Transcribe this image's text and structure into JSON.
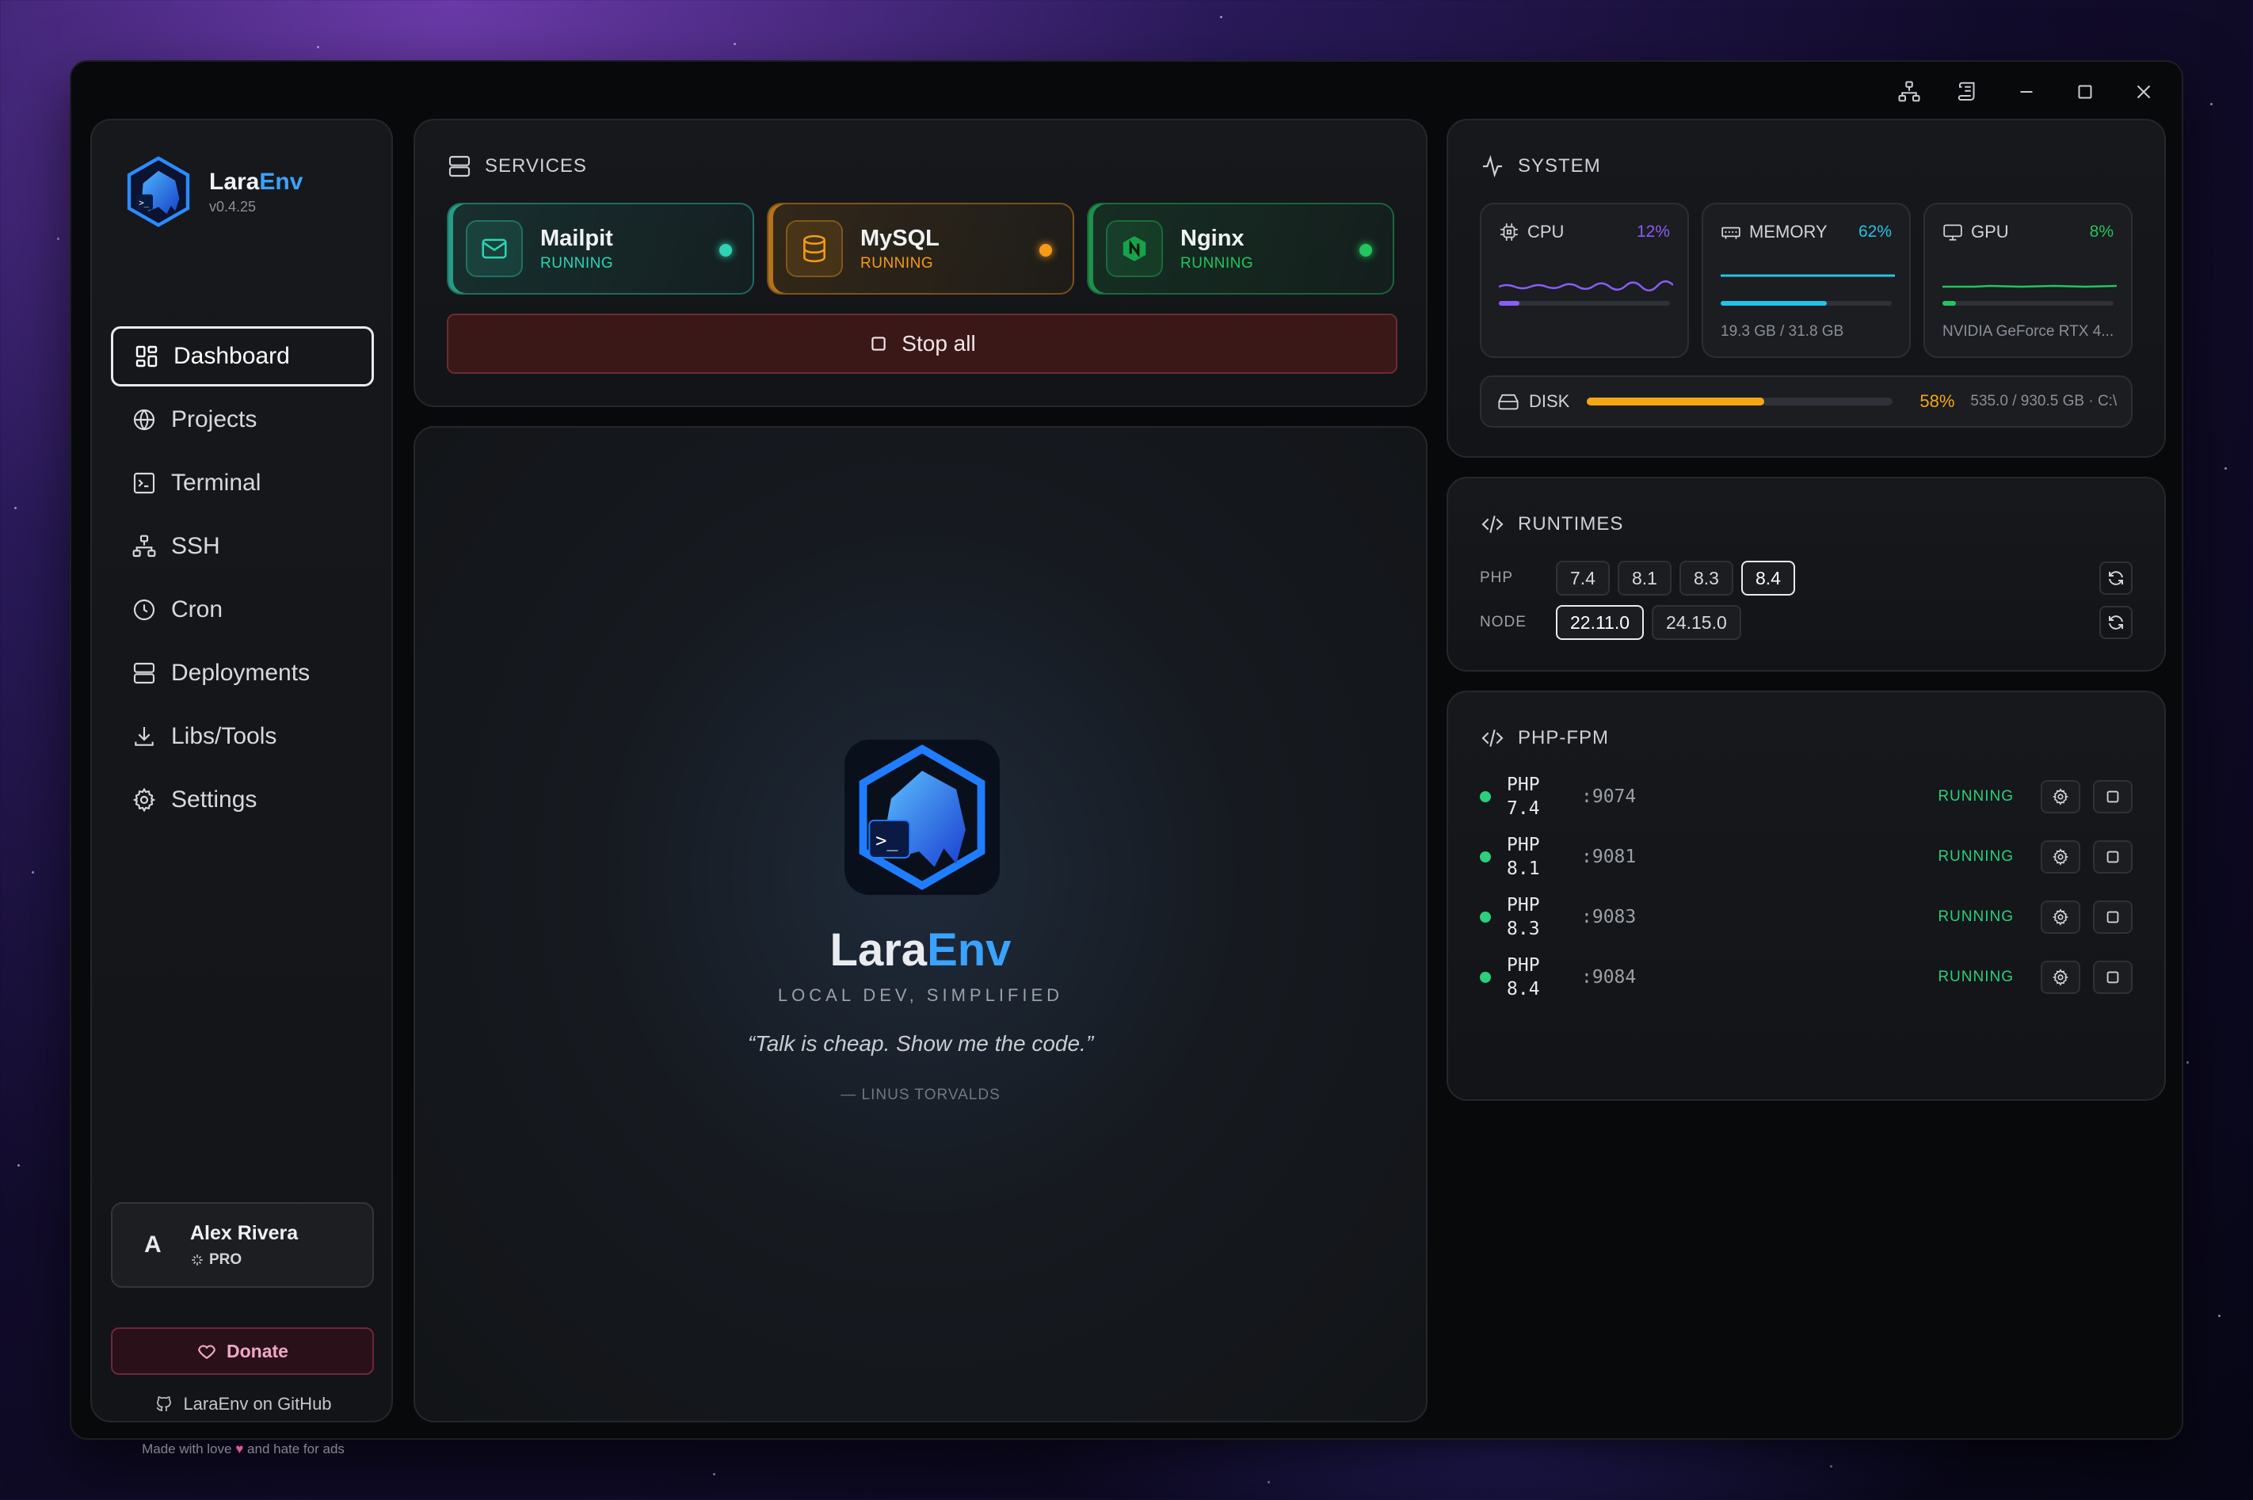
{
  "app": {
    "name_a": "Lara",
    "name_b": "Env",
    "version": "v0.4.25"
  },
  "sidebar": {
    "items": [
      {
        "label": "Dashboard",
        "icon": "dashboard-icon",
        "active": true
      },
      {
        "label": "Projects",
        "icon": "globe-icon"
      },
      {
        "label": "Terminal",
        "icon": "terminal-icon"
      },
      {
        "label": "SSH",
        "icon": "network-icon"
      },
      {
        "label": "Cron",
        "icon": "clock-icon"
      },
      {
        "label": "Deployments",
        "icon": "server-icon"
      },
      {
        "label": "Libs/Tools",
        "icon": "download-icon"
      },
      {
        "label": "Settings",
        "icon": "gear-icon"
      }
    ],
    "user": {
      "initial": "A",
      "name": "Alex Rivera",
      "plan": "PRO"
    },
    "donate": "Donate",
    "github": "LaraEnv on GitHub",
    "made_a": "Made with love",
    "made_b": "and hate for ads"
  },
  "services": {
    "title": "SERVICES",
    "items": [
      {
        "name": "Mailpit",
        "status": "RUNNING",
        "color": "#2fd3b3"
      },
      {
        "name": "MySQL",
        "status": "RUNNING",
        "color": "#f59b1a"
      },
      {
        "name": "Nginx",
        "status": "RUNNING",
        "color": "#22c55e"
      }
    ],
    "stop_all": "Stop all"
  },
  "hero": {
    "title_a": "Lara",
    "title_b": "Env",
    "tagline": "LOCAL DEV, SIMPLIFIED",
    "quote": "“Talk is cheap. Show me the code.”",
    "author": "— LINUS TORVALDS"
  },
  "system": {
    "title": "SYSTEM",
    "cpu": {
      "label": "CPU",
      "pct": "12%",
      "value": 0.12,
      "color": "#8b5cf6"
    },
    "memory": {
      "label": "MEMORY",
      "pct": "62%",
      "value": 0.62,
      "sub": "19.3 GB / 31.8 GB",
      "color": "#22c3e6"
    },
    "gpu": {
      "label": "GPU",
      "pct": "8%",
      "value": 0.08,
      "sub": "NVIDIA GeForce RTX 4...",
      "color": "#22c55e"
    },
    "disk": {
      "label": "DISK",
      "pct": "58%",
      "value": 0.58,
      "size": "535.0 / 930.5 GB · C:\\"
    }
  },
  "runtimes": {
    "title": "RUNTIMES",
    "php": {
      "label": "PHP",
      "versions": [
        "7.4",
        "8.1",
        "8.3",
        "8.4"
      ],
      "selected": "8.4"
    },
    "node": {
      "label": "NODE",
      "versions": [
        "22.11.0",
        "24.15.0"
      ],
      "selected": "22.11.0"
    }
  },
  "fpm": {
    "title": "PHP-FPM",
    "rows": [
      {
        "version": "PHP\n7.4",
        "port": ":9074",
        "status": "RUNNING"
      },
      {
        "version": "PHP\n8.1",
        "port": ":9081",
        "status": "RUNNING"
      },
      {
        "version": "PHP\n8.3",
        "port": ":9083",
        "status": "RUNNING"
      },
      {
        "version": "PHP\n8.4",
        "port": ":9084",
        "status": "RUNNING"
      }
    ]
  }
}
